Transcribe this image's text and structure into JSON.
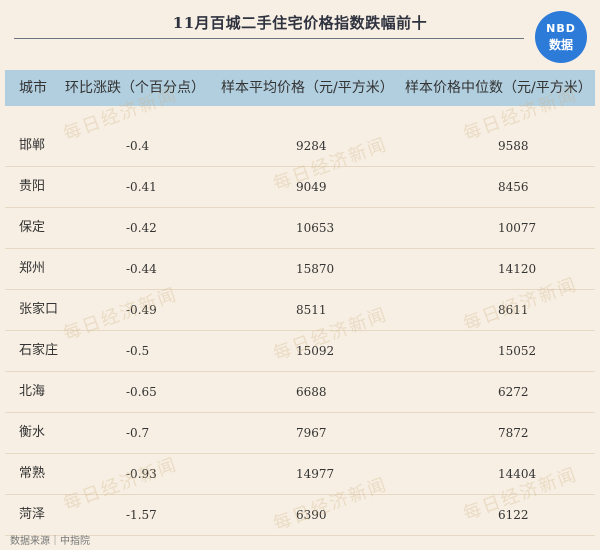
{
  "title": "11月百城二手住宅价格指数跌幅前十",
  "logo": {
    "line1": "NBD",
    "line2": "数据"
  },
  "watermark": "每日经济新闻",
  "source": "数据来源｜中指院",
  "chart_data": {
    "type": "table",
    "title": "11月百城二手住宅价格指数跌幅前十",
    "columns": [
      "城市",
      "环比涨跌（个百分点）",
      "样本平均价格（元/平方米）",
      "样本价格中位数（元/平方米）"
    ],
    "rows": [
      {
        "city": "邯郸",
        "change": "-0.4",
        "avg": "9284",
        "median": "9588"
      },
      {
        "city": "贵阳",
        "change": "-0.41",
        "avg": "9049",
        "median": "8456"
      },
      {
        "city": "保定",
        "change": "-0.42",
        "avg": "10653",
        "median": "10077"
      },
      {
        "city": "郑州",
        "change": "-0.44",
        "avg": "15870",
        "median": "14120"
      },
      {
        "city": "张家口",
        "change": "-0.49",
        "avg": "8511",
        "median": "8611"
      },
      {
        "city": "石家庄",
        "change": "-0.5",
        "avg": "15092",
        "median": "15052"
      },
      {
        "city": "北海",
        "change": "-0.65",
        "avg": "6688",
        "median": "6272"
      },
      {
        "city": "衡水",
        "change": "-0.7",
        "avg": "7967",
        "median": "7872"
      },
      {
        "city": "常熟",
        "change": "-0.93",
        "avg": "14977",
        "median": "14404"
      },
      {
        "city": "菏泽",
        "change": "-1.57",
        "avg": "6390",
        "median": "6122"
      }
    ]
  },
  "colors": {
    "background": "#f7efe3",
    "header": "#b2cfe0",
    "logo": "#2d7bd9"
  }
}
